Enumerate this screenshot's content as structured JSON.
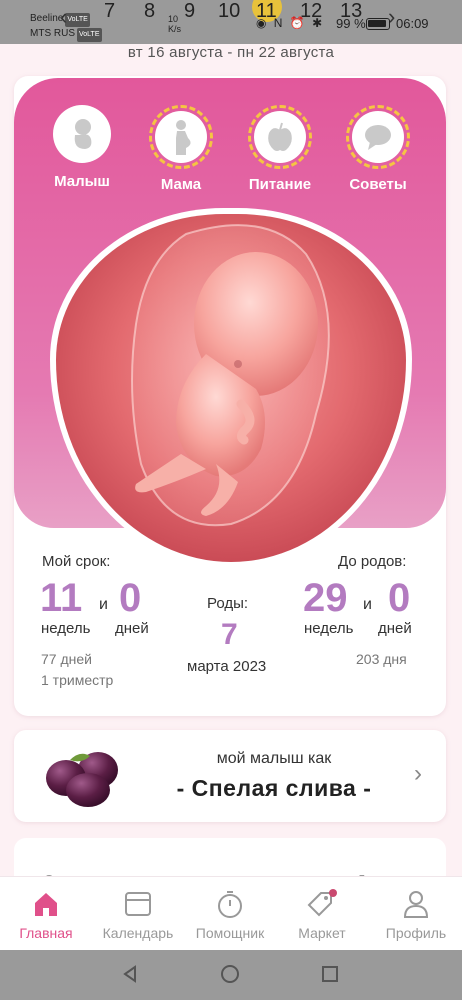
{
  "status_bar": {
    "operator1": "Beeline",
    "operator2": "MTS RUS",
    "volte": "VoLTE",
    "speed_value": "10",
    "speed_unit": "K/s",
    "battery": "99 %",
    "time": "06:09",
    "week_numbers": [
      "7",
      "8",
      "9",
      "10",
      "11",
      "12",
      "13"
    ],
    "current_week": "11"
  },
  "date_range": "вт 16 августа - пн 22 августа",
  "categories": [
    {
      "label": "Малыш",
      "icon": "baby-icon"
    },
    {
      "label": "Мама",
      "icon": "pregnant-icon"
    },
    {
      "label": "Питание",
      "icon": "apple-icon"
    },
    {
      "label": "Советы",
      "icon": "chat-icon"
    }
  ],
  "stats": {
    "my_term_label": "Мой срок:",
    "weeks": "11",
    "and": "и",
    "days": "0",
    "weeks_unit": "недель",
    "days_unit": "дней",
    "total_days": "77 дней",
    "trimester": "1 триместр",
    "due_label": "Роды:",
    "due_day": "7",
    "due_month": "марта 2023",
    "until_label": "До родов:",
    "until_weeks": "29",
    "until_days": "0",
    "until_total": "203 дня"
  },
  "fruit": {
    "prefix": "мой малыш как",
    "name": "- Спелая слива -"
  },
  "next_card": {
    "left": "Срок",
    "right": "До родов:"
  },
  "tabs": [
    {
      "label": "Главная",
      "icon": "home-icon",
      "active": true
    },
    {
      "label": "Календарь",
      "icon": "calendar-icon"
    },
    {
      "label": "Помощник",
      "icon": "stopwatch-icon"
    },
    {
      "label": "Маркет",
      "icon": "tag-icon"
    },
    {
      "label": "Профиль",
      "icon": "person-icon"
    }
  ],
  "colors": {
    "accent": "#e0508a",
    "stat_number": "#b37bc0",
    "hero_top": "#e2589b",
    "highlight_ring": "#f5c542"
  }
}
